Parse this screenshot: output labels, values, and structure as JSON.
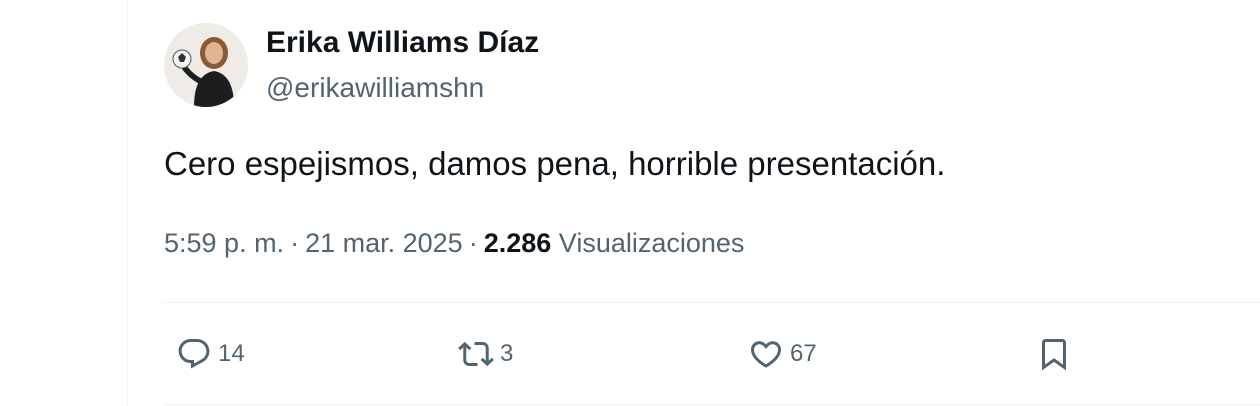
{
  "author": {
    "display_name": "Erika Williams Díaz",
    "handle": "@erikawilliamshn"
  },
  "tweet": {
    "text": "Cero espejismos, damos pena, horrible presentación.",
    "time": "5:59 p. m.",
    "date": "21 mar. 2025",
    "separator": "·",
    "views_count": "2.286",
    "views_label": "Visualizaciones"
  },
  "actions": {
    "reply_count": "14",
    "retweet_count": "3",
    "like_count": "67"
  },
  "icons": {
    "reply": "reply-icon",
    "retweet": "retweet-icon",
    "like": "heart-icon",
    "bookmark": "bookmark-icon"
  },
  "colors": {
    "text_primary": "#0f1419",
    "text_secondary": "#536471",
    "divider": "#eff3f4"
  }
}
